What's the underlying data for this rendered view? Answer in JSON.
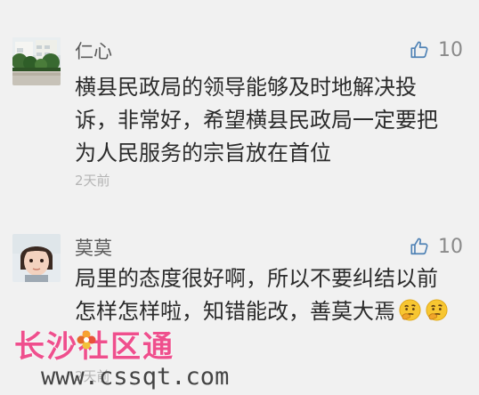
{
  "comments": [
    {
      "name": "仁心",
      "likes": "10",
      "lines": [
        "横县民政局的领导能够及时地解决投",
        "诉，非常好，希望横县民政局一定要把",
        "为人民服务的宗旨放在首位"
      ],
      "time": "2天前",
      "avatar": "avatar-photo-building"
    },
    {
      "name": "莫莫",
      "likes": "10",
      "lines": [
        "局里的态度很好啊，所以不要纠结以前",
        "怎样怎样啦，知错能改，善莫大焉"
      ],
      "time": "2天前",
      "avatar": "avatar-photo-child",
      "emojis": [
        "thinking-face-icon",
        "thinking-face-icon"
      ]
    }
  ],
  "watermark": {
    "title": "长沙社区通",
    "url": "www.cssqt.com"
  },
  "colors": {
    "background": "#f1f1f1",
    "text": "#2b2b2b",
    "name": "#5c5c5c",
    "meta": "#b5b5b5",
    "watermark": "#ef4f8d"
  }
}
